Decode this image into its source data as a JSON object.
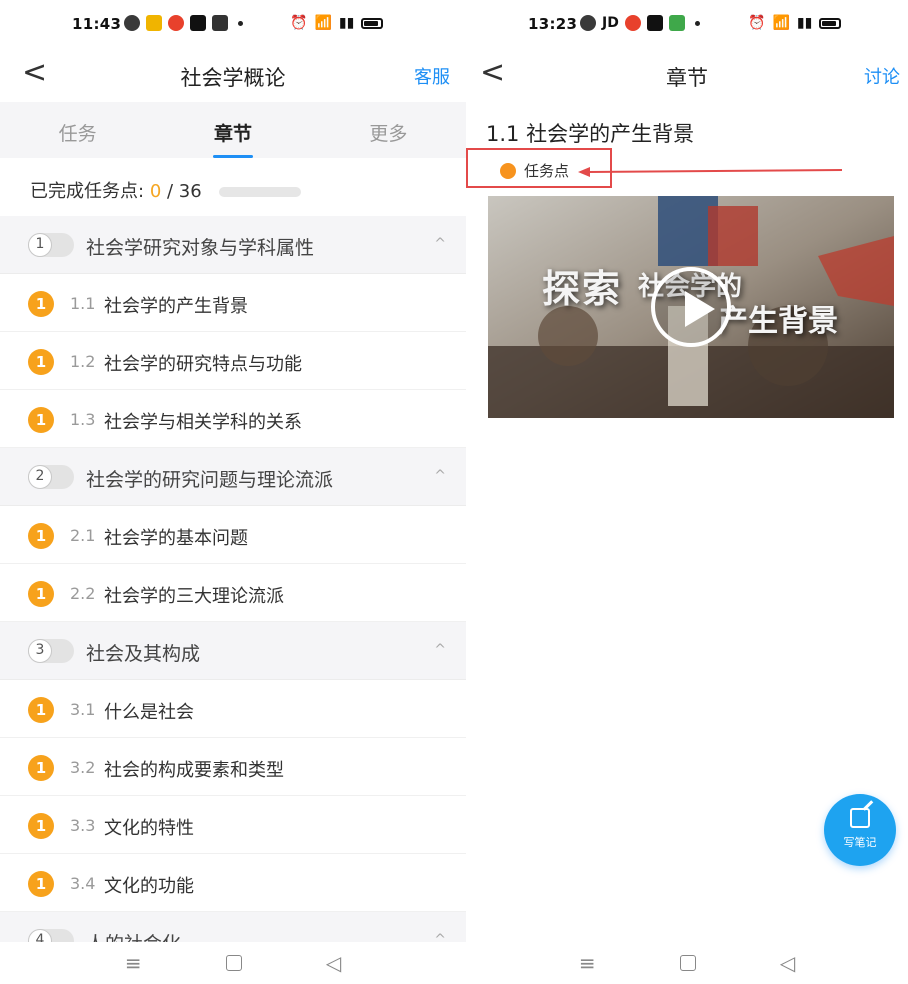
{
  "left": {
    "status": {
      "time": "11:43"
    },
    "nav": {
      "back": "<",
      "title": "社会学概论",
      "action": "客服"
    },
    "tabs": [
      {
        "label": "任务"
      },
      {
        "label": "章节"
      },
      {
        "label": "更多"
      }
    ],
    "progress": {
      "label": "已完成任务点:",
      "done": "0",
      "total": "/ 36"
    },
    "chapters": [
      {
        "num": "1",
        "title": "社会学研究对象与学科属性",
        "sections": [
          {
            "badge": "1",
            "num": "1.1",
            "title": " 社会学的产生背景"
          },
          {
            "badge": "1",
            "num": "1.2",
            "title": "社会学的研究特点与功能"
          },
          {
            "badge": "1",
            "num": "1.3",
            "title": "社会学与相关学科的关系"
          }
        ]
      },
      {
        "num": "2",
        "title": "社会学的研究问题与理论流派",
        "sections": [
          {
            "badge": "1",
            "num": "2.1",
            "title": "社会学的基本问题"
          },
          {
            "badge": "1",
            "num": "2.2",
            "title": "社会学的三大理论流派"
          }
        ]
      },
      {
        "num": "3",
        "title": "社会及其构成",
        "sections": [
          {
            "badge": "1",
            "num": "3.1",
            "title": "什么是社会"
          },
          {
            "badge": "1",
            "num": "3.2",
            "title": "社会的构成要素和类型"
          },
          {
            "badge": "1",
            "num": "3.3",
            "title": "文化的特性"
          },
          {
            "badge": "1",
            "num": "3.4",
            "title": "文化的功能"
          }
        ]
      },
      {
        "num": "4",
        "title": "人的社会化",
        "sections": []
      }
    ],
    "caret": "^"
  },
  "right": {
    "status": {
      "time": "13:23",
      "jd": "JD"
    },
    "nav": {
      "back": "<",
      "title": "章节",
      "action": "讨论"
    },
    "section_title": "1.1  社会学的产生背景",
    "task_point": "任务点",
    "video": {
      "text1": "探索",
      "text2": "社会学的",
      "text3": "产生背景"
    },
    "fab_label": "写笔记"
  },
  "sys_nav": {
    "menu": "≡",
    "back": "◁"
  },
  "colors": {
    "accent": "#1e8ff5",
    "badge": "#f7a21c",
    "annotation": "#e34a4a"
  }
}
